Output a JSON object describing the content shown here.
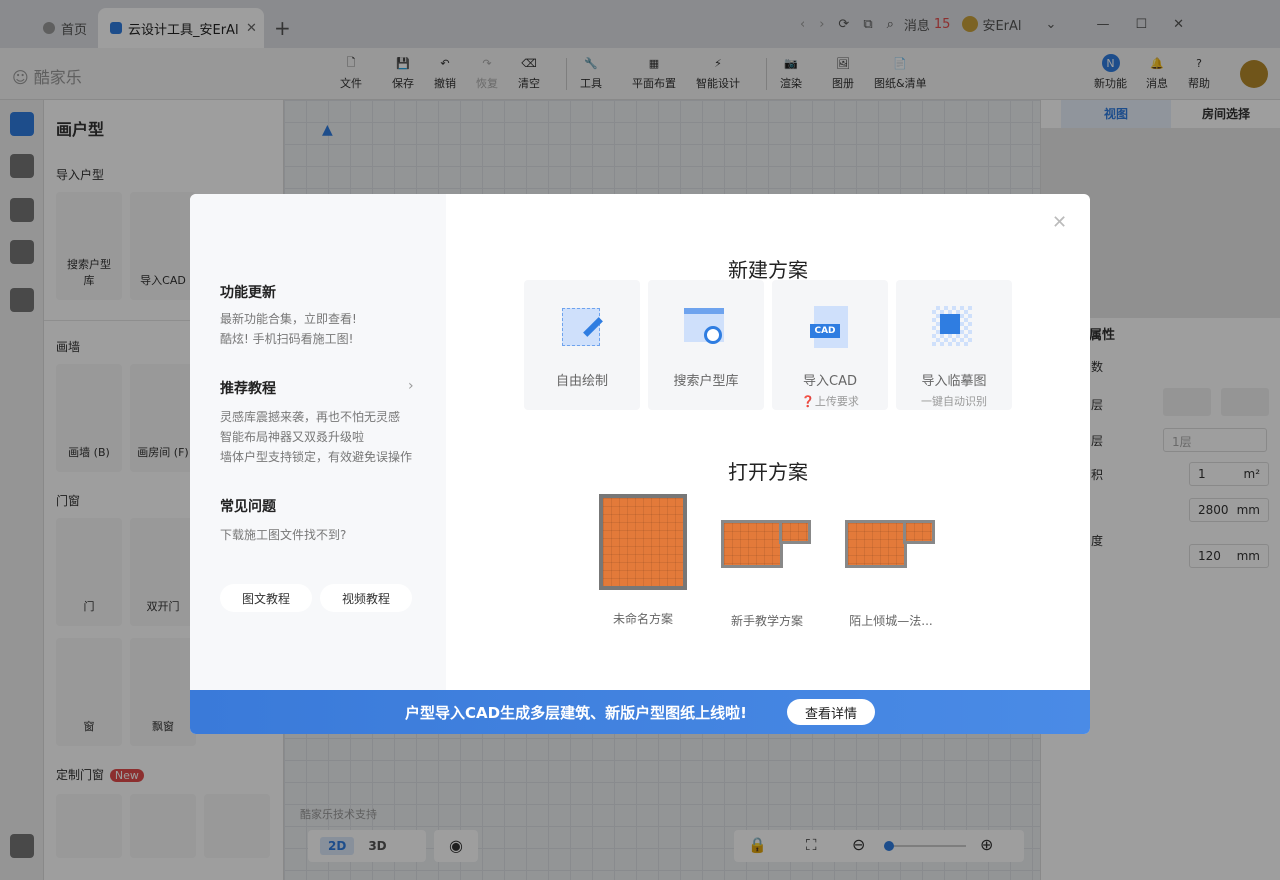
{
  "browser": {
    "home_tab": "首页",
    "active_tab": "云设计工具_安ErAl",
    "msg_label": "消息",
    "msg_count": "15",
    "user_name": "安ErAl"
  },
  "app": {
    "logo": "酷家乐",
    "toolbar": [
      {
        "label": "文件"
      },
      {
        "label": "保存"
      },
      {
        "label": "撤销"
      },
      {
        "label": "恢复"
      },
      {
        "label": "清空"
      },
      {
        "label": "工具"
      },
      {
        "label": "平面布置"
      },
      {
        "label": "智能设计"
      },
      {
        "label": "渲染"
      },
      {
        "label": "图册"
      },
      {
        "label": "图纸&清单"
      }
    ],
    "right_tools": [
      {
        "label": "新功能"
      },
      {
        "label": "消息"
      },
      {
        "label": "帮助"
      }
    ]
  },
  "left_panel": {
    "title": "画户型",
    "section_import": "导入户型",
    "import_tiles": [
      "搜索户型库",
      "导入CAD"
    ],
    "section_wall": "画墙",
    "wall_tiles": [
      "画墙 (B)",
      "画房间 (F)"
    ],
    "section_door": "门窗",
    "door_tiles": [
      "门",
      "双开门",
      "窗",
      "飘窗"
    ],
    "section_custom": "定制门窗",
    "new_badge": "New"
  },
  "canvas": {
    "support": "酷家乐技术支持",
    "mode_2d": "2D",
    "mode_3d": "3D"
  },
  "right_panel": {
    "tab_view": "视图",
    "tab_room": "房间选择",
    "props_title": "属性",
    "param_label": "数",
    "row_layer": "层",
    "row_floor": "层",
    "floor_value": "1层",
    "row_area": "积",
    "area_value": "1",
    "area_unit": "m²",
    "height_value": "2800",
    "height_unit": "mm",
    "row_thick": "度",
    "thick_value": "120",
    "thick_unit": "mm"
  },
  "modal": {
    "updates_title": "功能更新",
    "updates_lines": [
      "最新功能合集，立即查看!",
      "酷炫! 手机扫码看施工图!"
    ],
    "tutorial_title": "推荐教程",
    "tutorial_lines": [
      "灵感库震撼来袭，再也不怕无灵感",
      "智能布局神器又双叒升级啦",
      "墙体户型支持锁定，有效避免误操作"
    ],
    "faq_title": "常见问题",
    "faq_lines": [
      "下载施工图文件找不到?"
    ],
    "btn_text_tutorial": "图文教程",
    "btn_video_tutorial": "视频教程",
    "new_plan_title": "新建方案",
    "new_cards": [
      {
        "label": "自由绘制",
        "sub": ""
      },
      {
        "label": "搜索户型库",
        "sub": ""
      },
      {
        "label": "导入CAD",
        "sub": "上传要求"
      },
      {
        "label": "导入临摹图",
        "sub": "一键自动识别"
      }
    ],
    "open_plan_title": "打开方案",
    "projects": [
      "未命名方案",
      "新手教学方案",
      "陌上倾城—法..."
    ],
    "banner_text": "户型导入CAD生成多层建筑、新版户型图纸上线啦!",
    "banner_button": "查看详情",
    "cad_badge": "CAD"
  },
  "colors": {
    "accent": "#3a7ad9",
    "badge_red": "#e34d4d"
  }
}
